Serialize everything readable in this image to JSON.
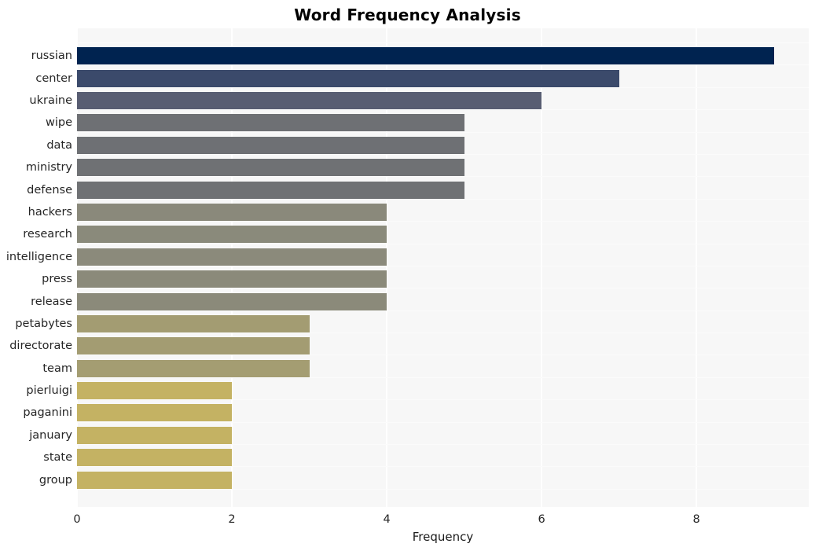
{
  "chart_data": {
    "type": "bar",
    "orientation": "horizontal",
    "title": "Word Frequency Analysis",
    "xlabel": "Frequency",
    "ylabel": "",
    "xlim": [
      0,
      9.45
    ],
    "xticks": [
      0,
      2,
      4,
      6,
      8
    ],
    "xticklabels": [
      "0",
      "2",
      "4",
      "6",
      "8"
    ],
    "grid": true,
    "legend": null,
    "categories": [
      "russian",
      "center",
      "ukraine",
      "wipe",
      "data",
      "ministry",
      "defense",
      "hackers",
      "research",
      "intelligence",
      "press",
      "release",
      "petabytes",
      "directorate",
      "team",
      "pierluigi",
      "paganini",
      "january",
      "state",
      "group"
    ],
    "values": [
      9,
      7,
      6,
      5,
      5,
      5,
      5,
      4,
      4,
      4,
      4,
      4,
      3,
      3,
      3,
      2,
      2,
      2,
      2,
      2
    ],
    "colors": [
      "#002350",
      "#3b4a6b",
      "#585d72",
      "#6e7074",
      "#6e7074",
      "#6f7174",
      "#6f7174",
      "#8a897b",
      "#8a8a7b",
      "#8b8a7b",
      "#8b8a7a",
      "#8b8a7a",
      "#a39c72",
      "#a39c72",
      "#a49d72",
      "#c4b263",
      "#c4b263",
      "#c4b263",
      "#c4b263",
      "#c4b263"
    ],
    "palette_name": "cividis",
    "background_color": "#f7f7f7",
    "gridline_color": "#ffffff",
    "figure_background": "#ffffff"
  },
  "figure": {
    "title": "Word Frequency Analysis",
    "axis_title_x": "Frequency"
  }
}
